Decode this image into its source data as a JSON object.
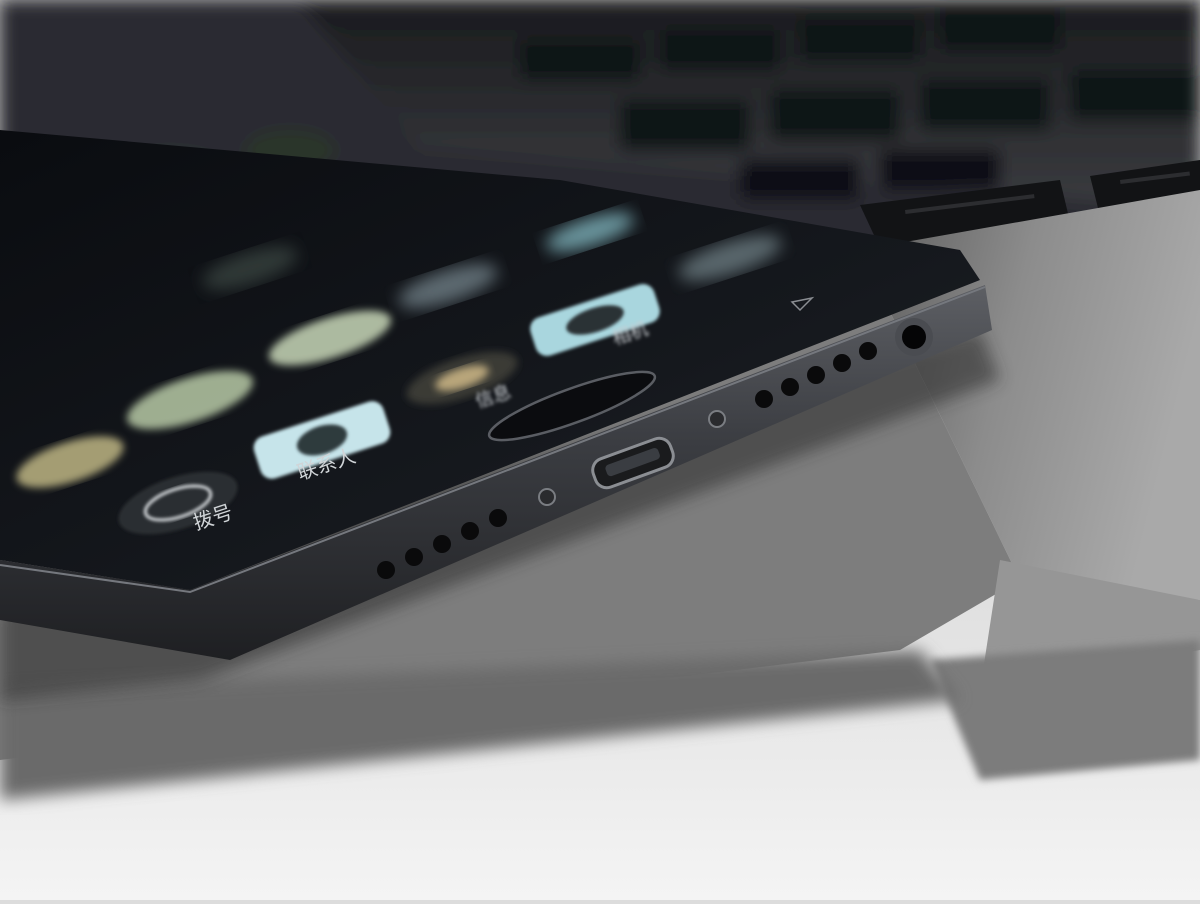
{
  "scene": {
    "description_labels": {
      "dial": "拨号",
      "contacts": "联系人",
      "messages": "信息",
      "camera": "相机"
    },
    "colors": {
      "desk": "#e6e6e6",
      "laptop_body": "#8a8a8a",
      "laptop_dark": "#2a2a2c",
      "phone_frame": "#3a3b3f",
      "phone_screen": "#0e1014",
      "icon_tint": "#9fd1d9"
    }
  }
}
